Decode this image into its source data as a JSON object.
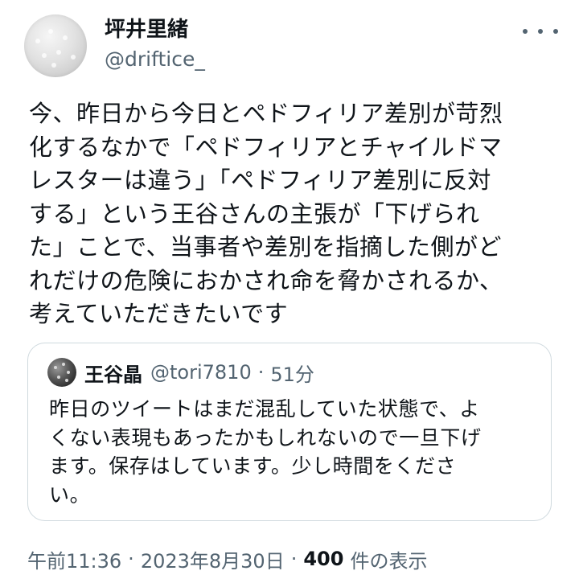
{
  "author": {
    "display_name": "坪井里緒",
    "handle": "@driftice_"
  },
  "icons": {
    "more": "more-horizontal-icon",
    "avatar": "avatar-image",
    "quote_avatar": "avatar-image"
  },
  "colors": {
    "text_primary": "#0f1419",
    "text_secondary": "#536471",
    "border": "#cfd9de"
  },
  "tweet": {
    "lines": [
      "今、昨日から今日とペドフィリア差別が苛烈",
      "化するなかで「ペドフィリアとチャイルドマ",
      "レスターは違う」「ペドフィリア差別に反対",
      "する」という王谷さんの主張が「下げられ",
      "た」ことで、当事者や差別を指摘した側がど",
      "れだけの危険におかされ命を脅かされるか、",
      "考えていただきたいです"
    ]
  },
  "quote": {
    "display_name": "王谷晶",
    "handle": "@tori7810",
    "separator": "·",
    "time": "51分",
    "lines": [
      "昨日のツイートはまだ混乱していた状態で、よ",
      "くない表現もあったかもしれないので一旦下げ",
      "ます。保存はしています。少し時間をくださ",
      "い。"
    ]
  },
  "meta": {
    "time": "午前11:36",
    "separator": "·",
    "date": "2023年8月30日",
    "separator2": "·",
    "views_count": "400",
    "views_label": "件の表示"
  }
}
